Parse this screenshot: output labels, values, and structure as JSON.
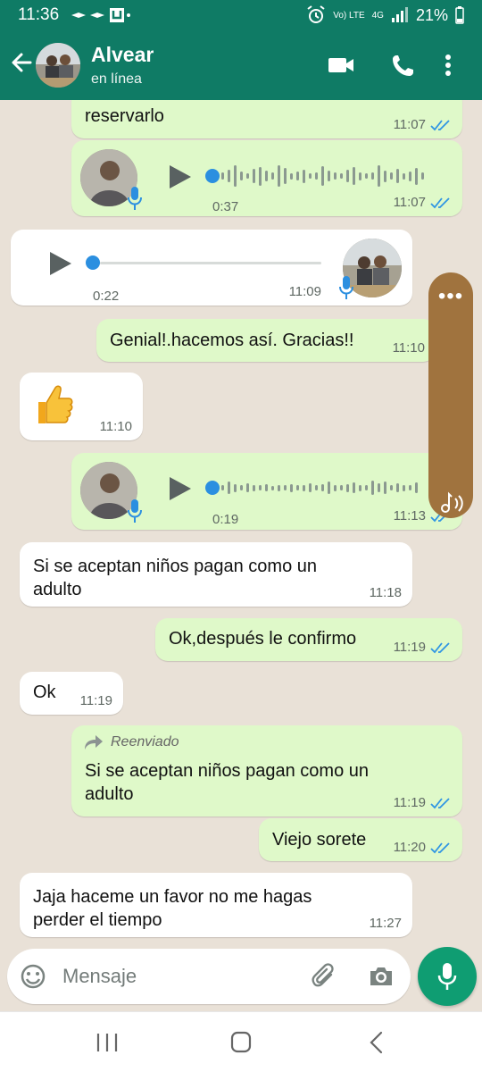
{
  "status_bar": {
    "time": "11:36",
    "carrier_small": "Vo) LTE",
    "network": "4G",
    "battery": "21%"
  },
  "header": {
    "name": "Alvear",
    "status": "en línea"
  },
  "messages": [
    {
      "text": "reservarlo",
      "time": "11:07"
    },
    {
      "duration": "0:37",
      "time": "11:07"
    },
    {
      "duration": "0:22",
      "time": "11:09"
    },
    {
      "text": "Genial!.hacemos así. Gracias!!",
      "time": "11:10"
    },
    {
      "text": "👍",
      "time": "11:10"
    },
    {
      "duration": "0:19",
      "time": "11:13"
    },
    {
      "text": "Si se aceptan niños pagan como un adulto",
      "time": "11:18"
    },
    {
      "text": "Ok,después le confirmo",
      "time": "11:19"
    },
    {
      "text": "Ok",
      "time": "11:19"
    },
    {
      "forward_label": "Reenviado",
      "text": "Si se aceptan niños pagan como un adulto",
      "time": "11:19"
    },
    {
      "text": "Viejo sorete",
      "time": "11:20"
    },
    {
      "text": "Jaja haceme un favor no me hagas perder el tiempo",
      "time": "11:27"
    }
  ],
  "composer": {
    "placeholder": "Mensaje"
  },
  "colors": {
    "header": "#0f7b65",
    "outgoing_bubble": "#dff9c9",
    "incoming_bubble": "#ffffff",
    "read_ticks": "#2f95e3",
    "mic_button": "#0f9d72"
  }
}
